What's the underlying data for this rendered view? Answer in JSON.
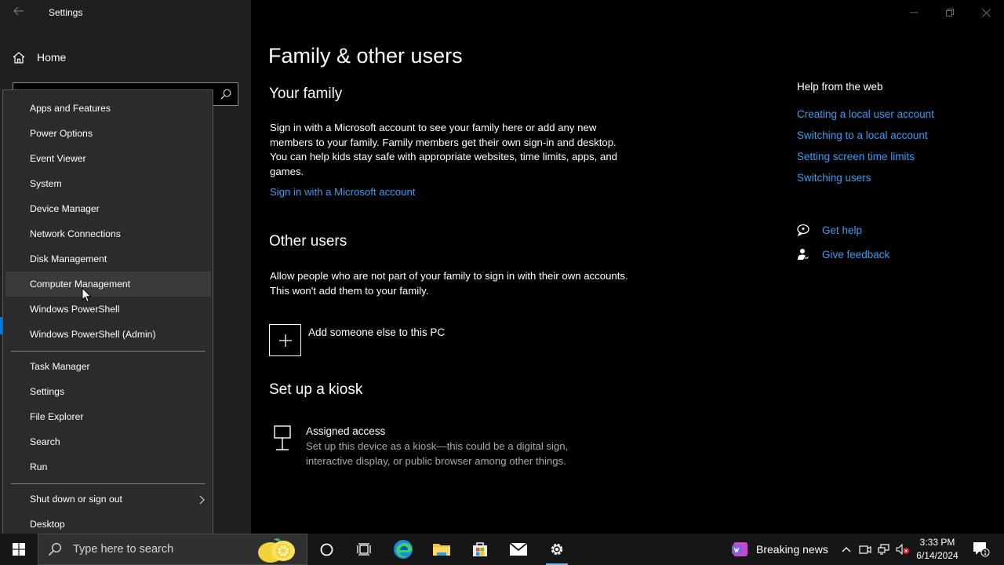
{
  "window": {
    "title": "Settings",
    "controls": [
      "minimize",
      "restore",
      "close"
    ]
  },
  "left_pane": {
    "home_label": "Home",
    "search_placeholder": ""
  },
  "main": {
    "page_title": "Family & other users",
    "family": {
      "heading": "Your family",
      "description": "Sign in with a Microsoft account to see your family here or add any new members to your family. Family members get their own sign-in and desktop. You can help kids stay safe with appropriate websites, time limits, apps, and games.",
      "link": "Sign in with a Microsoft account"
    },
    "other_users": {
      "heading": "Other users",
      "description": "Allow people who are not part of your family to sign in with their own accounts. This won't add them to your family.",
      "add_label": "Add someone else to this PC"
    },
    "kiosk": {
      "heading": "Set up a kiosk",
      "title": "Assigned access",
      "description": "Set up this device as a kiosk—this could be a digital sign, interactive display, or public browser among other things."
    }
  },
  "help": {
    "heading": "Help from the web",
    "links": [
      "Creating a local user account",
      "Switching to a local account",
      "Setting screen time limits",
      "Switching users"
    ],
    "get_help": "Get help",
    "give_feedback": "Give feedback"
  },
  "context_menu": {
    "group1": [
      "Apps and Features",
      "Power Options",
      "Event Viewer",
      "System",
      "Device Manager",
      "Network Connections",
      "Disk Management",
      "Computer Management",
      "Windows PowerShell",
      "Windows PowerShell (Admin)"
    ],
    "group2": [
      "Task Manager",
      "Settings",
      "File Explorer",
      "Search",
      "Run"
    ],
    "group3": [
      "Shut down or sign out",
      "Desktop"
    ],
    "hovered_item": "Computer Management"
  },
  "taskbar": {
    "search_placeholder": "Type here to search",
    "news_label": "Breaking news",
    "time": "3:33 PM",
    "date": "6/14/2024",
    "notification_count": "1",
    "apps": [
      "cortana-icon",
      "task-view-icon",
      "edge-icon",
      "file-explorer-icon",
      "store-icon",
      "mail-icon",
      "settings-icon"
    ],
    "active_app": "settings-icon"
  },
  "colors": {
    "accent": "#0078d4",
    "link": "#3a9bf3",
    "menu_bg": "#2b2b2b",
    "left_pane_bg": "#1f1f1f"
  }
}
